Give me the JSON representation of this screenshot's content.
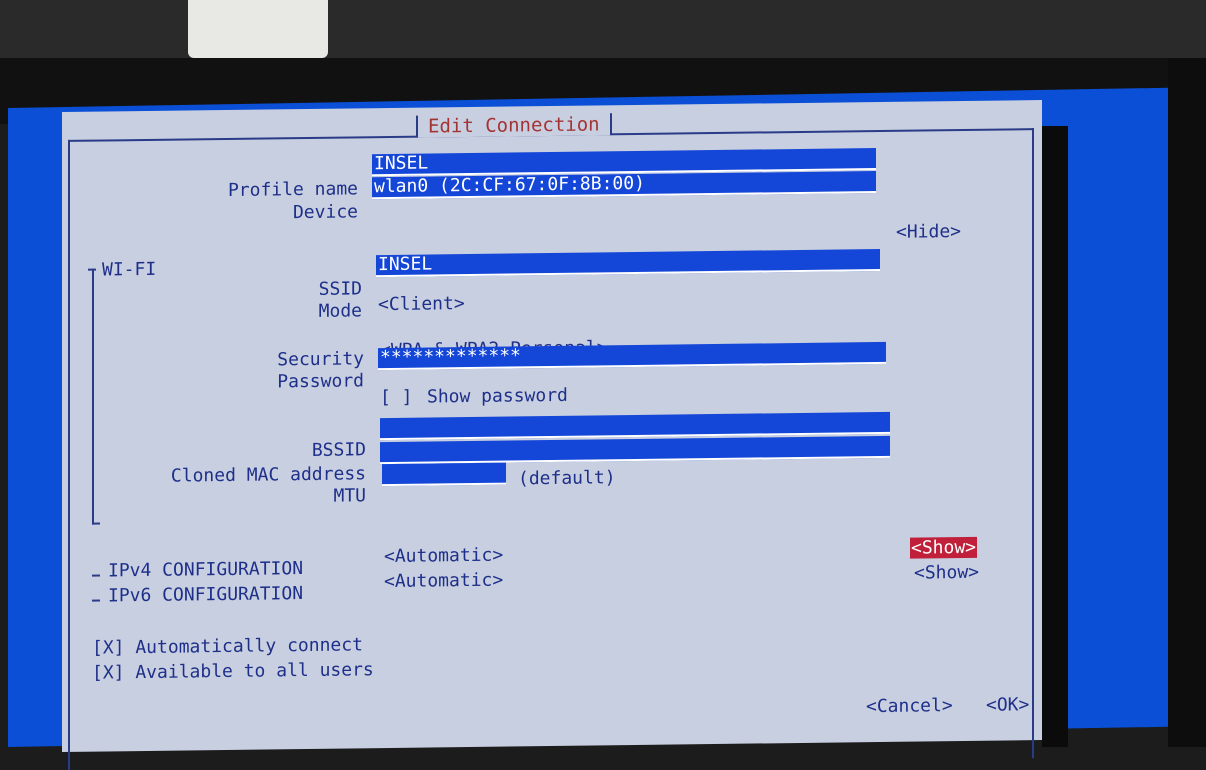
{
  "dialog": {
    "title": "Edit Connection"
  },
  "profile": {
    "name_label": "Profile name",
    "name_value": "INSEL",
    "device_label": "Device",
    "device_value": "wlan0 (2C:CF:67:0F:8B:00)",
    "hide_button": "<Hide>"
  },
  "wifi": {
    "section_label": "WI-FI",
    "ssid_label": "SSID",
    "ssid_value": "INSEL",
    "mode_label": "Mode",
    "mode_value": "<Client>",
    "security_label": "Security",
    "security_value": "<WPA & WPA2 Personal>",
    "password_label": "Password",
    "password_value": "*************",
    "show_password_checkbox": "[ ]",
    "show_password_label": "Show password",
    "bssid_label": "BSSID",
    "bssid_value": "",
    "cloned_mac_label": "Cloned MAC address",
    "cloned_mac_value": "",
    "mtu_label": "MTU",
    "mtu_value": "",
    "mtu_hint": "(default)"
  },
  "ipv4": {
    "label": "IPv4 CONFIGURATION",
    "mode": "<Automatic>",
    "show_button": "<Show>"
  },
  "ipv6": {
    "label": "IPv6 CONFIGURATION",
    "mode": "<Automatic>",
    "show_button": "<Show>"
  },
  "options": {
    "auto_connect": "[X] Automatically connect",
    "all_users": "[X] Available to all users"
  },
  "footer": {
    "cancel": "<Cancel>",
    "ok": "<OK>"
  },
  "colors": {
    "screen_blue": "#0a4fd6",
    "dialog_bg": "#c8cfe0",
    "field_bg": "#1446d8",
    "title_red": "#a43434",
    "focus_red": "#c0203a",
    "text_blue": "#1e2f8a"
  }
}
